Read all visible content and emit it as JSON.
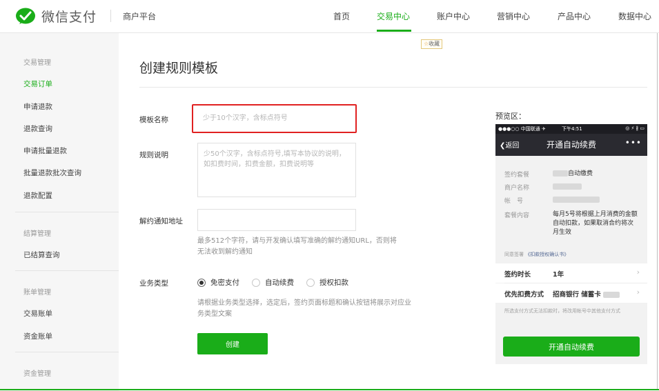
{
  "header": {
    "logo_text": "微信支付",
    "platform": "商户平台",
    "nav": [
      "首页",
      "交易中心",
      "账户中心",
      "营销中心",
      "产品中心",
      "数据中心"
    ],
    "active_nav": "交易中心"
  },
  "sidebar": {
    "group_trade": "交易管理",
    "items_trade": [
      "交易订单",
      "申请退款",
      "退款查询",
      "申请批量退款",
      "批量退款批次查询",
      "退款配置"
    ],
    "group_settle": "结算管理",
    "items_settle": [
      "已结算查询"
    ],
    "group_bill": "账单管理",
    "items_bill": [
      "交易账单",
      "资金账单"
    ],
    "group_fund": "资金管理"
  },
  "main": {
    "favorite": "收藏",
    "title": "创建规则模板",
    "name_label": "模板名称",
    "name_placeholder": "少于10个汉字，含标点符号",
    "desc_label": "规则说明",
    "desc_placeholder": "少50个汉字，含标点符号,填写本协议的说明，如扣费时间，扣费金额，扣费说明等",
    "notify_label": "解约通知地址",
    "notify_value": "",
    "notify_hint": "最多512个字符，请与开发确认填写准确的解约通知URL，否则将无法收到解约通知",
    "type_label": "业务类型",
    "types": [
      "免密支付",
      "自动续费",
      "授权扣款"
    ],
    "selected_type": "免密支付",
    "type_hint": "请根据业务类型选择，选定后，签约页面标题和确认按钮将展示对应业务类型文案",
    "create_button": "创建"
  },
  "preview": {
    "label": "预览区：",
    "status_carrier": "●●●○○ 中国联通 ✈",
    "status_time": "下午4:51",
    "status_right": "◎ ⚡ ∦ ▭",
    "back": "返回",
    "nav_title": "开通自动续费",
    "more": "•••",
    "plan_key": "签约套餐",
    "plan_value": "自动缴费",
    "merchant_key": "商户名称",
    "account_key": "帐　号",
    "content_key": "套餐内容",
    "content_value": "每月5号将根据上月消费的金额自动扣款，如果取消合约将次月生效",
    "agree_text": "同意签署",
    "agree_link": "《扣款授权确认书》",
    "duration_key": "签约时长",
    "duration_value": "1年",
    "method_key": "优先扣费方式",
    "method_value": "招商银行 储蓄卡",
    "note": "所选支付方式无法扣款时，将改用帐号中其他支付方式",
    "button": "开通自动续费"
  },
  "colors": {
    "accent": "#1aad19",
    "highlight": "#e02020"
  }
}
